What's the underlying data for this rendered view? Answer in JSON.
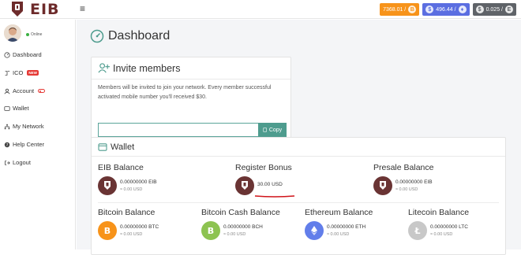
{
  "app": {
    "name": "EIB"
  },
  "topbar": {
    "menu_icon": "menu-icon",
    "prices": [
      {
        "label": "7368.01 / ",
        "symbol": "B",
        "color": "#f7931a",
        "icon": "bitcoin-icon"
      },
      {
        "label": "496.44 / ",
        "symbol": "♦",
        "color": "#5b6ee1",
        "icon": "ethereum-icon"
      },
      {
        "label": "0.025 / ",
        "symbol": "E",
        "color": "#5f6368",
        "icon": "eib-icon"
      }
    ]
  },
  "user": {
    "status": "Online",
    "status_color": "#3cb043"
  },
  "sidebar": {
    "items": [
      {
        "label": "Dashboard",
        "icon": "gauge-icon"
      },
      {
        "label": "ICO",
        "icon": "ico-icon",
        "badge": "NEW"
      },
      {
        "label": "Account",
        "icon": "user-icon"
      },
      {
        "label": "Wallet",
        "icon": "wallet-icon"
      },
      {
        "label": "My Network",
        "icon": "network-icon"
      },
      {
        "label": "Help Center",
        "icon": "help-icon"
      },
      {
        "label": "Logout",
        "icon": "logout-icon"
      }
    ]
  },
  "main": {
    "title": "Dashboard",
    "invite": {
      "title": "Invite members",
      "description": "Members will be invited to join your network. Every member successful activated mobile number you'll received $30.",
      "input_value": "",
      "copy_label": "Copy"
    },
    "wallet": {
      "title": "Wallet",
      "balances": [
        {
          "title": "EIB Balance",
          "amount": "0.00000000 EIB",
          "usd": "≈ 0.00 USD",
          "coin": "eib"
        },
        {
          "title": "Register Bonus",
          "amount": "30.00 USD",
          "usd": "≈ 0.00 USD",
          "coin": "eib"
        },
        {
          "title": "Presale Balance",
          "amount": "0.00000000 EIB",
          "usd": "≈ 0.00 USD",
          "coin": "eib"
        },
        {
          "title": "Bitcoin Balance",
          "amount": "0.00000000 BTC",
          "usd": "≈ 0.00 USD",
          "coin": "btc"
        },
        {
          "title": "Bitcoin Cash Balance",
          "amount": "0.00000000 BCH",
          "usd": "≈ 0.00 USD",
          "coin": "bch"
        },
        {
          "title": "Ethereum Balance",
          "amount": "0.00000000 ETH",
          "usd": "≈ 0.00 USD",
          "coin": "eth"
        },
        {
          "title": "Litecoin Balance",
          "amount": "0.00000000 LTC",
          "usd": "≈ 0.00 USD",
          "coin": "ltc"
        }
      ]
    }
  }
}
